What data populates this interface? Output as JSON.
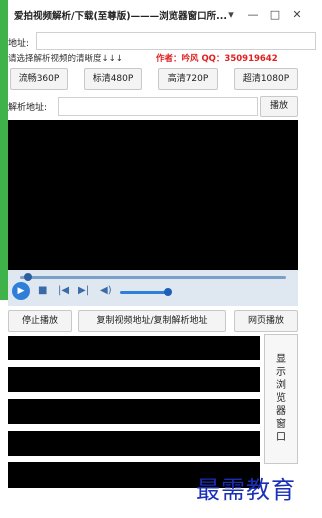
{
  "window": {
    "title": "爱拍视频解析/下载(至尊版)———浏览器窗口所...",
    "controls": {
      "menu": "▾",
      "minimize": "—",
      "maximize": "□",
      "close": "✕"
    }
  },
  "address": {
    "label": "地址:",
    "value": ""
  },
  "quality": {
    "hint": "请选择解析视频的清晰度↓↓↓",
    "author": "作者：吟风    QQ：350919642",
    "buttons": [
      "流畅360P",
      "标清480P",
      "高清720P",
      "超清1080P"
    ]
  },
  "parse": {
    "label": "解析地址:",
    "value": "",
    "play_label": "播放"
  },
  "player": {
    "icons": [
      "play-icon",
      "stop-icon",
      "previous-icon",
      "next-icon",
      "volume-icon"
    ],
    "seek_fraction": 0.03,
    "volume_fraction": 0.85
  },
  "actions": {
    "stop_label": "停止播放",
    "copy_label": "复制视频地址/复制解析地址",
    "web_label": "网页播放"
  },
  "side_button": {
    "label_chars": [
      "显",
      "示",
      "浏",
      "览",
      "器",
      "窗",
      "口"
    ]
  },
  "watermark": "最需教育"
}
